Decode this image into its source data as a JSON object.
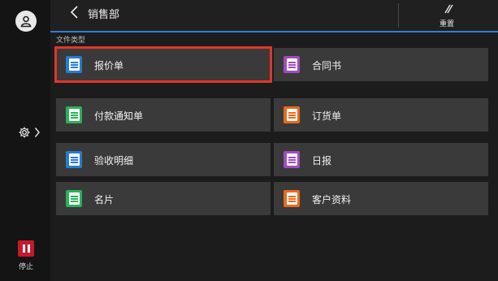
{
  "header": {
    "title": "销售部",
    "reset_label": "重置"
  },
  "section_label": "文件类型",
  "rail": {
    "stop_label": "停止"
  },
  "colors": {
    "blue": "#2a7bd0",
    "green": "#2bb05a",
    "purple": "#a24bbf",
    "orange": "#ea6a1a",
    "selection": "#e2362a"
  },
  "doc_types": [
    {
      "label": "报价单",
      "color": "blue",
      "selected": true
    },
    {
      "label": "合同书",
      "color": "purple"
    },
    {
      "label": "付款通知单",
      "color": "green"
    },
    {
      "label": "订货单",
      "color": "orange"
    },
    {
      "label": "验收明细",
      "color": "blue"
    },
    {
      "label": "日报",
      "color": "purple"
    },
    {
      "label": "名片",
      "color": "green"
    },
    {
      "label": "客户资料",
      "color": "orange"
    }
  ]
}
